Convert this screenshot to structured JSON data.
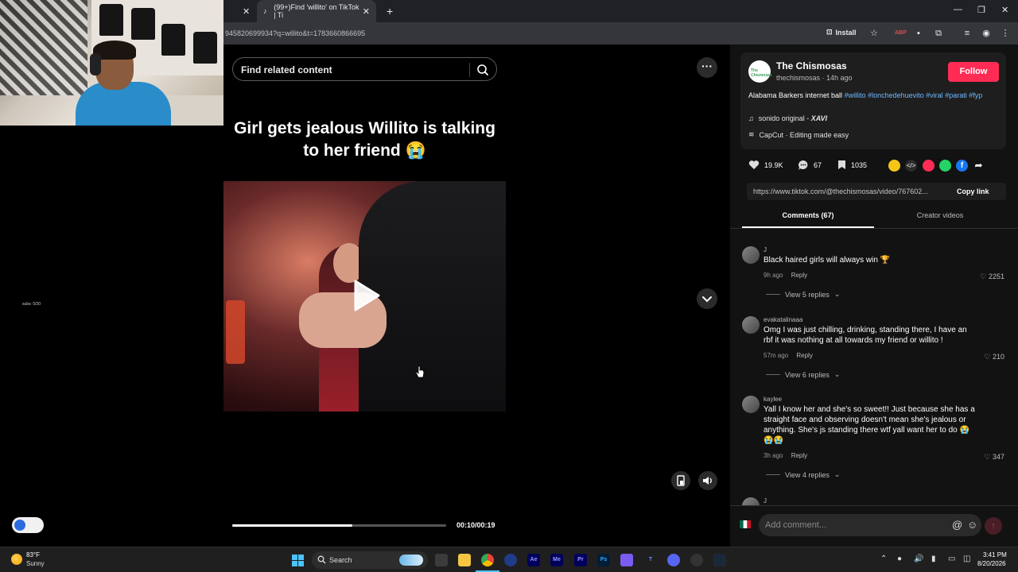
{
  "webcam": {
    "subs_label": "subs: 0/20"
  },
  "browser": {
    "tabs": [
      {
        "label": ""
      },
      {
        "label": "(99+)Find 'willito' on TikTok | Ti"
      }
    ],
    "url": "945820699934?q=willito&t=1783660866695",
    "install_label": "Install"
  },
  "video": {
    "search_placeholder": "Find related content",
    "caption": "Girl gets jealous Willito is talking to her friend 😭",
    "time": "00:10/00:19",
    "progress": 0.56
  },
  "author": {
    "name": "The Chismosas",
    "meta": "thechismosas · 14h ago",
    "follow_label": "Follow",
    "avatar_text": "The Chismosas",
    "desc_text": "Alabama Barkers internet ball ",
    "hashtags": [
      "#willito",
      "#lonchedehuevito",
      "#viral",
      "#parati",
      "#fyp"
    ],
    "sound": "sonido original - ",
    "sound_artist": "XAVI",
    "capcut": "CapCut · Editing made easy"
  },
  "stats": {
    "likes": "19.9K",
    "comments": "67",
    "saves": "1035"
  },
  "share": {
    "link": "https://www.tiktok.com/@thechismosas/video/767602...",
    "copy_label": "Copy link"
  },
  "panel_tabs": {
    "comments": "Comments (67)",
    "creator": "Creator videos"
  },
  "comments": [
    {
      "user": "J",
      "text": "Black haired girls will always win 🏆",
      "time": "9h ago",
      "reply": "Reply",
      "likes": "2251",
      "replies": "View 5 replies"
    },
    {
      "user": "evakatalinaaa",
      "text": "Omg I was just chilling, drinking, standing there, I have an rbf it was nothing at all towards my friend or willito !",
      "time": "57m ago",
      "reply": "Reply",
      "likes": "210",
      "replies": "View 6 replies"
    },
    {
      "user": "kaylee",
      "text": "Yall I know her and she's so sweet!! Just because she has a straight face and observing doesn't mean she's jealous or anything. She's js standing there wtf yall want her to do 😭😭😭",
      "time": "3h ago",
      "reply": "Reply",
      "likes": "347",
      "replies": "View 4 replies"
    },
    {
      "user": "J"
    }
  ],
  "comment_bar": {
    "placeholder": "Add comment..."
  },
  "taskbar": {
    "weather_temp": "83°F",
    "weather_cond": "Sunny",
    "search_label": "Search",
    "time": "3:41 PM",
    "date": "8/20/2026"
  },
  "colors": {
    "follow": "#fe2c55",
    "hashtag": "#6fb8ff",
    "panel_bg": "#121212"
  },
  "icons": [
    "search-icon",
    "play-icon",
    "more-icon",
    "chevron-down-icon",
    "heart-icon",
    "comment-icon",
    "bookmark-icon",
    "link-icon",
    "at-icon",
    "emoji-icon",
    "send-icon",
    "volume-icon",
    "windows-start-icon"
  ]
}
